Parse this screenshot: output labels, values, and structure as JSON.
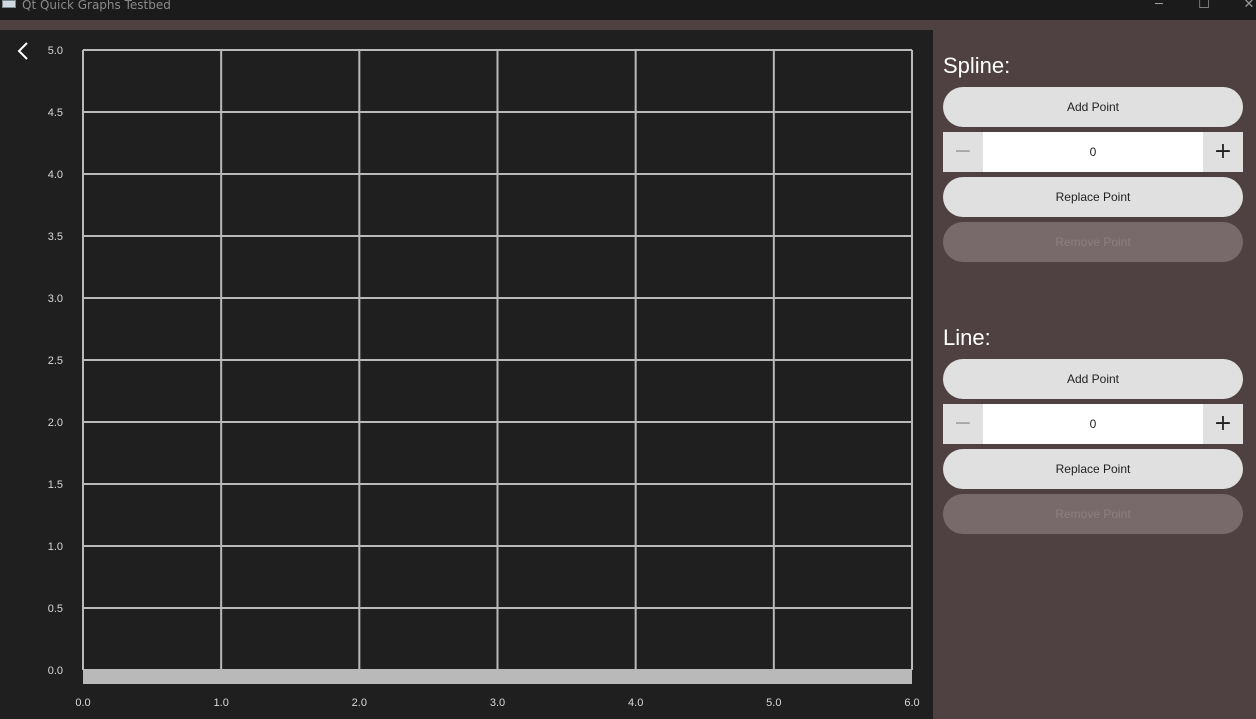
{
  "window": {
    "title": "Qt Quick Graphs Testbed",
    "controls": [
      "─",
      "☐",
      "✕"
    ]
  },
  "icons": {
    "back": "chevron-left-icon",
    "minus": "minus-icon",
    "plus": "plus-icon"
  },
  "colors": {
    "panel_bg": "#4f4141",
    "plot_bg": "#1f1f1f",
    "grid": "#b9b9b9",
    "button_bg": "#e0e0e0",
    "button_disabled_bg": "#786a6a"
  },
  "chart_data": {
    "type": "line",
    "title": "",
    "xlabel": "",
    "ylabel": "",
    "xlim": [
      0,
      6
    ],
    "ylim": [
      0,
      5
    ],
    "x_ticks": [
      "0.0",
      "1.0",
      "2.0",
      "3.0",
      "4.0",
      "5.0",
      "6.0"
    ],
    "y_ticks": [
      "0.0",
      "0.5",
      "1.0",
      "1.5",
      "2.0",
      "2.5",
      "3.0",
      "3.5",
      "4.0",
      "4.5",
      "5.0"
    ],
    "grid": true,
    "series": []
  },
  "spline": {
    "title": "Spline:",
    "add_label": "Add Point",
    "spin_value": "0",
    "minus_label": "−",
    "plus_label": "+",
    "replace_label": "Replace Point",
    "remove_label": "Remove Point"
  },
  "line": {
    "title": "Line:",
    "add_label": "Add Point",
    "spin_value": "0",
    "minus_label": "−",
    "plus_label": "+",
    "replace_label": "Replace Point",
    "remove_label": "Remove Point"
  }
}
